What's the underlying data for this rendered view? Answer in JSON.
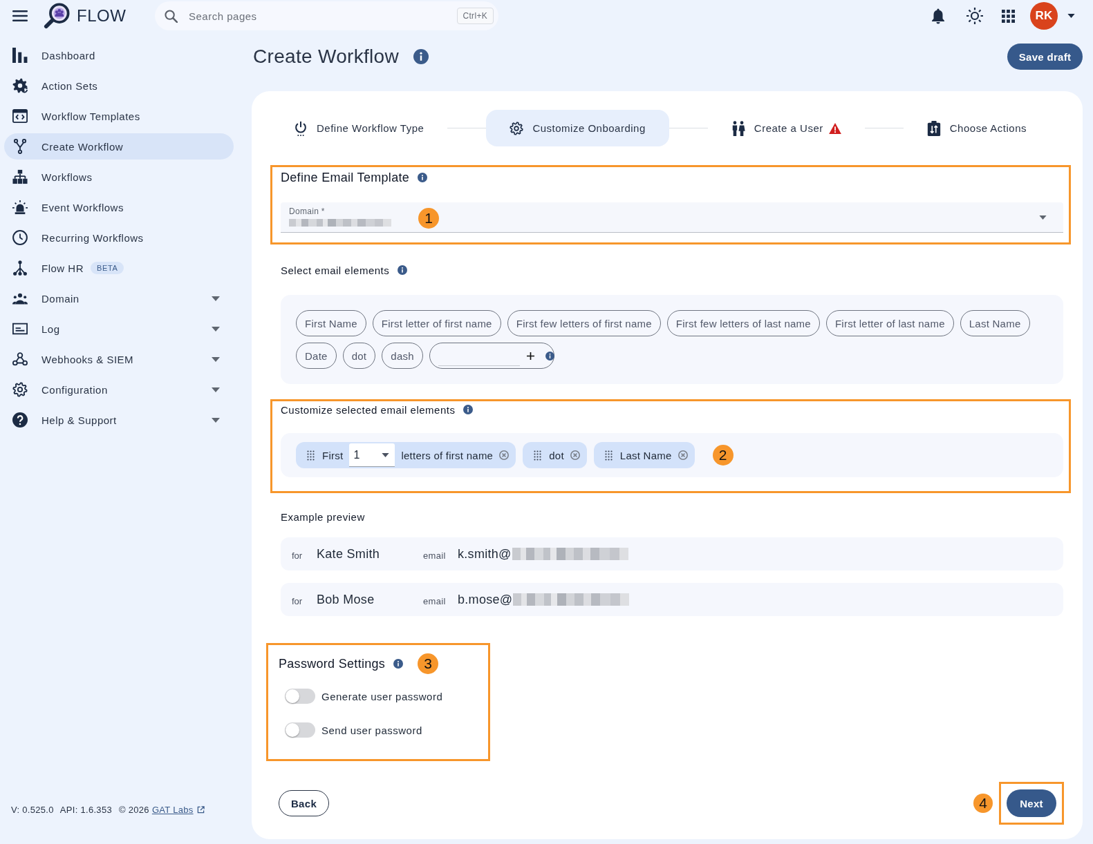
{
  "header": {
    "app_name": "FLOW",
    "search": {
      "placeholder": "Search pages",
      "shortcut": "Ctrl+K"
    },
    "avatar": {
      "initials": "RK"
    }
  },
  "sidebar": {
    "items": [
      {
        "label": "Dashboard",
        "selected": false,
        "expandable": false
      },
      {
        "label": "Action Sets",
        "selected": false,
        "expandable": false
      },
      {
        "label": "Workflow Templates",
        "selected": false,
        "expandable": false
      },
      {
        "label": "Create Workflow",
        "selected": true,
        "expandable": false
      },
      {
        "label": "Workflows",
        "selected": false,
        "expandable": false
      },
      {
        "label": "Event Workflows",
        "selected": false,
        "expandable": false
      },
      {
        "label": "Recurring Workflows",
        "selected": false,
        "expandable": false
      },
      {
        "label": "Flow HR",
        "badge": "BETA",
        "selected": false,
        "expandable": false
      },
      {
        "label": "Domain",
        "selected": false,
        "expandable": true
      },
      {
        "label": "Log",
        "selected": false,
        "expandable": true
      },
      {
        "label": "Webhooks & SIEM",
        "selected": false,
        "expandable": true
      },
      {
        "label": "Configuration",
        "selected": false,
        "expandable": true
      },
      {
        "label": "Help & Support",
        "selected": false,
        "expandable": true
      }
    ],
    "footer": {
      "version": "V: 0.525.0",
      "api": "API: 1.6.353",
      "copyright": "© 2026",
      "link": "GAT Labs"
    }
  },
  "page": {
    "title": "Create Workflow",
    "save_button": "Save draft"
  },
  "stepper": {
    "steps": [
      {
        "label": "Define Workflow Type",
        "selected": false,
        "warning": false
      },
      {
        "label": "Customize Onboarding",
        "selected": true,
        "warning": false
      },
      {
        "label": "Create a User",
        "selected": false,
        "warning": true
      },
      {
        "label": "Choose Actions",
        "selected": false,
        "warning": false
      }
    ]
  },
  "email_template": {
    "title": "Define Email Template",
    "highlighted": true,
    "callout": "1",
    "domain_field": {
      "label": "Domain *"
    }
  },
  "select_elements": {
    "title": "Select email elements",
    "chips": [
      {
        "label": "First Name"
      },
      {
        "label": "First letter of first name"
      },
      {
        "label": "First few letters of first name"
      },
      {
        "label": "First few letters of last name"
      },
      {
        "label": "First letter of last name"
      },
      {
        "label": "Last Name"
      },
      {
        "label": "Date"
      },
      {
        "label": "dot"
      },
      {
        "label": "dash"
      }
    ]
  },
  "customize_elements": {
    "title": "Customize selected email elements",
    "highlighted": true,
    "callout": "2",
    "chips": [
      {
        "kind": "count",
        "prefix": "First",
        "value": "1",
        "suffix": "letters of first name"
      },
      {
        "kind": "plain",
        "label": "dot"
      },
      {
        "kind": "plain",
        "label": "Last Name"
      }
    ]
  },
  "preview": {
    "title": "Example preview",
    "rows": [
      {
        "for_label": "for",
        "name": "Kate Smith",
        "email_label": "email",
        "email": "k.smith@"
      },
      {
        "for_label": "for",
        "name": "Bob Mose",
        "email_label": "email",
        "email": "b.mose@"
      }
    ]
  },
  "password_settings": {
    "title": "Password Settings",
    "highlighted": true,
    "callout": "3",
    "toggles": [
      {
        "label": "Generate user password",
        "on": false
      },
      {
        "label": "Send user password",
        "on": false
      }
    ]
  },
  "actions": {
    "back": "Back",
    "next": {
      "label": "Next",
      "highlighted": true,
      "callout": "4"
    }
  }
}
